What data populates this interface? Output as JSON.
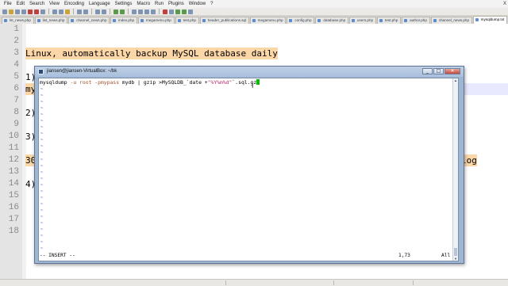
{
  "menu": [
    "File",
    "Edit",
    "Search",
    "View",
    "Encoding",
    "Language",
    "Settings",
    "Macro",
    "Run",
    "Plugins",
    "Window",
    "?"
  ],
  "window_controls": "X",
  "tabs": [
    {
      "label": "lst_news.php",
      "active": false
    },
    {
      "label": "list_news.php",
      "active": false
    },
    {
      "label": "channel_news.php",
      "active": false
    },
    {
      "label": "index.php",
      "active": false
    },
    {
      "label": "megamenu.php",
      "active": false
    },
    {
      "label": "test.php",
      "active": false
    },
    {
      "label": "header_publications.sql",
      "active": false
    },
    {
      "label": "megamenu.php",
      "active": false
    },
    {
      "label": "config.php",
      "active": false
    },
    {
      "label": "database.php",
      "active": false
    },
    {
      "label": "users.php",
      "active": false
    },
    {
      "label": "test.php",
      "active": false
    },
    {
      "label": "author.php",
      "active": false
    },
    {
      "label": "channel_news.php",
      "active": false
    },
    {
      "label": "mysqldump.txt",
      "active": true
    }
  ],
  "editor": {
    "line_numbers": [
      "1",
      "2",
      "3",
      "4",
      "5",
      "6",
      "7",
      "8",
      "9",
      "10",
      "11",
      "12",
      "13",
      "14",
      "15",
      "16",
      "17",
      "18"
    ],
    "heading": "Linux, automatically backup MySQL database daily",
    "step1": "1)",
    "line6": "my",
    "step2": "2)",
    "step3": "3)",
    "line12_left": "30",
    "line12_right": "log",
    "step4": "4)"
  },
  "terminal": {
    "title": "jiansen@jiansen-VirtualBox: ~/bk",
    "buttons": {
      "minimize": "_",
      "maximize": "□",
      "close": "✕"
    },
    "cmd_parts": {
      "p1": "mysqldump ",
      "p2": "-u root -pmypass",
      "p3": " mydb | gzip >MySQLDB_`date +",
      "p4": "\"%Y%m%d\"",
      "p5": "`.sql.gz"
    },
    "mode": "-- INSERT --",
    "position": "1,73",
    "percent": "All"
  }
}
